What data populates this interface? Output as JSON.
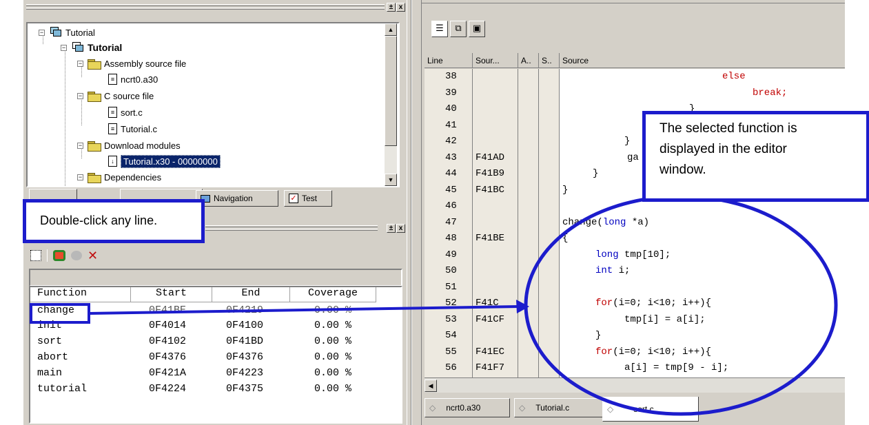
{
  "workspace": {
    "tree": [
      {
        "label": "Tutorial",
        "bold": false
      },
      {
        "label": "Tutorial",
        "bold": true
      },
      {
        "label": "Assembly source file"
      },
      {
        "label": "ncrt0.a30"
      },
      {
        "label": "C source file"
      },
      {
        "label": "sort.c"
      },
      {
        "label": "Tutorial.c"
      },
      {
        "label": "Download modules"
      },
      {
        "label": "Tutorial.x30 - 00000000"
      },
      {
        "label": "Dependencies"
      }
    ],
    "tabs": {
      "navigation": "Navigation",
      "test": "Test"
    },
    "close": "x"
  },
  "coverage": {
    "headers": {
      "function": "Function",
      "start": "Start",
      "end": "End",
      "coverage": "Coverage"
    },
    "rows": [
      {
        "function": "change",
        "start": "0F41BE",
        "end": "0F4219",
        "coverage": "0.00 %"
      },
      {
        "function": "init",
        "start": "0F4014",
        "end": "0F4100",
        "coverage": "0.00 %"
      },
      {
        "function": "sort",
        "start": "0F4102",
        "end": "0F41BD",
        "coverage": "0.00 %"
      },
      {
        "function": "abort",
        "start": "0F4376",
        "end": "0F4376",
        "coverage": "0.00 %"
      },
      {
        "function": "main",
        "start": "0F421A",
        "end": "0F4223",
        "coverage": "0.00 %"
      },
      {
        "function": "tutorial",
        "start": "0F4224",
        "end": "0F4375",
        "coverage": "0.00 %"
      }
    ]
  },
  "editor": {
    "headers": {
      "line": "Line",
      "source_addr": "Sour...",
      "a": "A..",
      "s": "S..",
      "source": "Source"
    },
    "lines": [
      {
        "n": "38",
        "addr": "",
        "code": "else"
      },
      {
        "n": "39",
        "addr": "",
        "code": "break;"
      },
      {
        "n": "40",
        "addr": "",
        "code": "}"
      },
      {
        "n": "41",
        "addr": "",
        "code": ""
      },
      {
        "n": "42",
        "addr": "",
        "code": "}"
      },
      {
        "n": "43",
        "addr": "F41AD",
        "code": "ga"
      },
      {
        "n": "44",
        "addr": "F41B9",
        "code": "}"
      },
      {
        "n": "45",
        "addr": "F41BC",
        "code": "}"
      },
      {
        "n": "46",
        "addr": "",
        "code": ""
      },
      {
        "n": "47",
        "addr": "",
        "code": "change(long *a)"
      },
      {
        "n": "48",
        "addr": "F41BE",
        "code": "{"
      },
      {
        "n": "49",
        "addr": "",
        "code": "long tmp[10];"
      },
      {
        "n": "50",
        "addr": "",
        "code": "int i;"
      },
      {
        "n": "51",
        "addr": "",
        "code": ""
      },
      {
        "n": "52",
        "addr": "F41C",
        "code": "for(i=0; i<10; i++){"
      },
      {
        "n": "53",
        "addr": "F41CF",
        "code": "tmp[i] = a[i];"
      },
      {
        "n": "54",
        "addr": "",
        "code": "}"
      },
      {
        "n": "55",
        "addr": "F41EC",
        "code": "for(i=0; i<10; i++){"
      },
      {
        "n": "56",
        "addr": "F41F7",
        "code": "a[i] = tmp[9 - i];"
      }
    ],
    "tabs": [
      "ncrt0.a30",
      "Tutorial.c",
      "sort.c"
    ]
  },
  "callouts": {
    "double_click": "Double-click any line.",
    "selected_line1": "The selected function is",
    "selected_line2": "displayed in the editor",
    "selected_line3": "window."
  },
  "colors": {
    "callout_border": "#1c1ccc",
    "selection": "#0a246a",
    "keyword_red": "#c00000",
    "keyword_blue": "#0000c0"
  }
}
